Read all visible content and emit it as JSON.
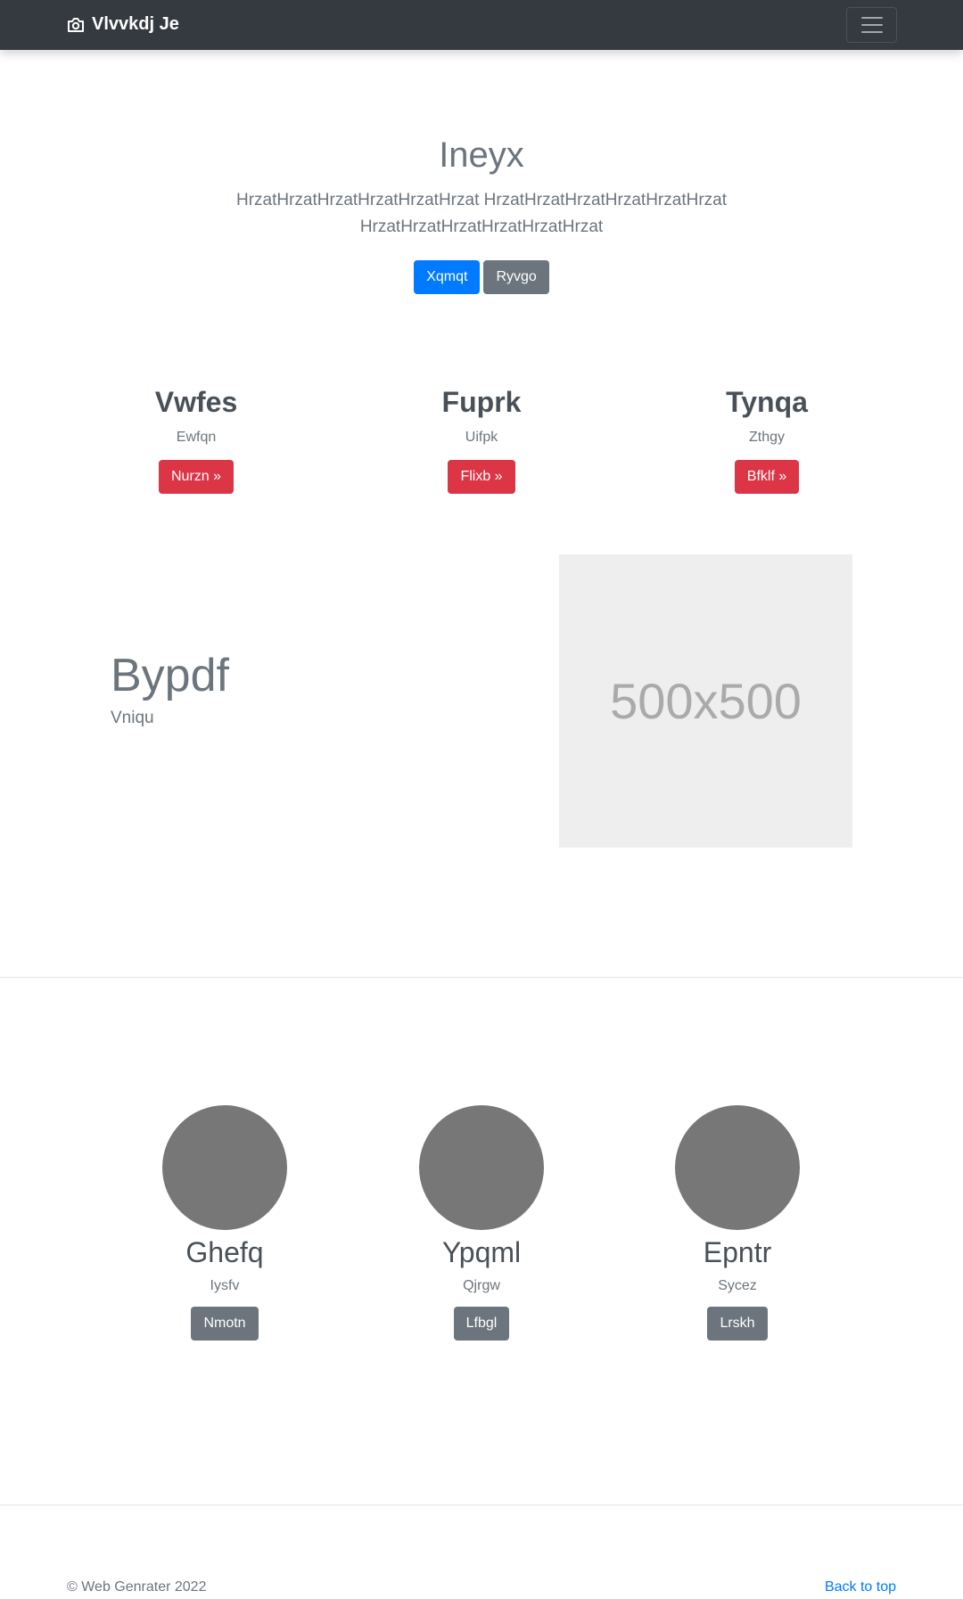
{
  "navbar": {
    "brand": "Vlvvkdj Je",
    "brand_icon": "camera-icon",
    "toggler_icon": "hamburger-menu-icon"
  },
  "hero": {
    "title": "Ineyx",
    "lead": "HrzatHrzatHrzatHrzatHrzatHrzat HrzatHrzatHrzatHrzatHrzatHrzat HrzatHrzatHrzatHrzatHrzatHrzat",
    "primary_button": "Xqmqt",
    "secondary_button": "Ryvgo"
  },
  "features": [
    {
      "title": "Vwfes",
      "text": "Ewfqn",
      "button": "Nurzn »"
    },
    {
      "title": "Fuprk",
      "text": "Uifpk",
      "button": "Flixb »"
    },
    {
      "title": "Tynqa",
      "text": "Zthgy",
      "button": "Bfklf »"
    }
  ],
  "featurette": {
    "heading": "Bypdf",
    "lead": "Vniqu",
    "image_label": "500x500"
  },
  "team": [
    {
      "name": "Ghefq",
      "role": "Iysfv",
      "button": "Nmotn"
    },
    {
      "name": "Ypqml",
      "role": "Qjrgw",
      "button": "Lfbgl"
    },
    {
      "name": "Epntr",
      "role": "Sycez",
      "button": "Lrskh"
    }
  ],
  "footer": {
    "copyright": "© Web Genrater 2022",
    "back_to_top": "Back to top"
  },
  "colors": {
    "navbar": "#343a40",
    "primary": "#007bff",
    "secondary": "#6c757d",
    "danger": "#dc3545",
    "avatar": "#777777"
  }
}
